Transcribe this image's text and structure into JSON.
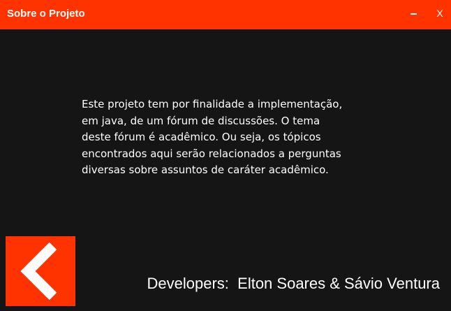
{
  "window": {
    "title": "Sobre o Projeto",
    "minimize_icon": "minimize-icon",
    "close_label": "X",
    "accent_color": "#ff3300",
    "background_color": "#151515"
  },
  "main": {
    "description": "Este projeto tem por finalidade a implementação,\nem java, de um fórum de discussões. O tema\ndeste fórum é acadêmico. Ou seja, os tópicos\nencontrados aqui serão relacionados a perguntas\ndiversas sobre assuntos de caráter acadêmico."
  },
  "footer": {
    "back_icon": "chevron-left-icon",
    "credits": "Developers:  Elton Soares & Sávio Ventura"
  }
}
